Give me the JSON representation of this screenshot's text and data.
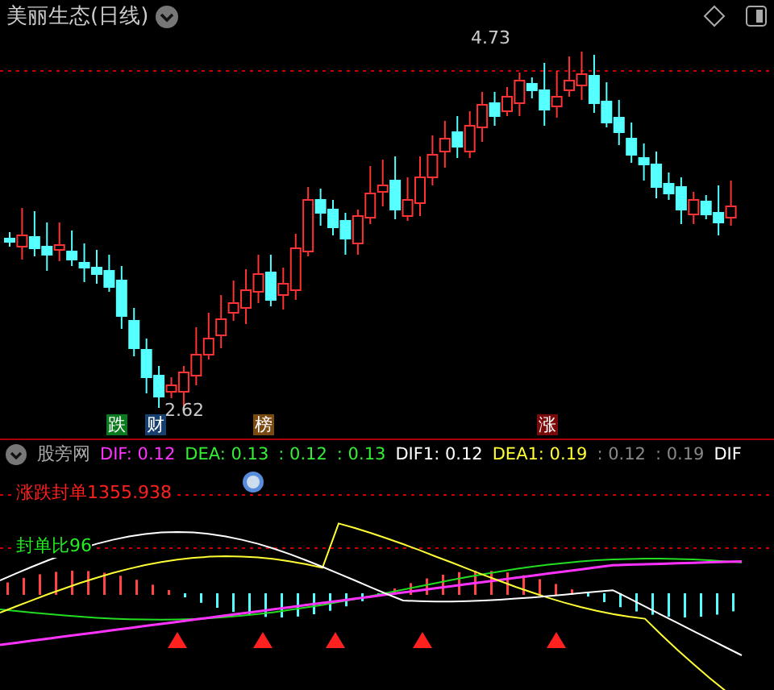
{
  "title": "美丽生态(日线)",
  "price_labels": [
    {
      "text": "4.73"
    },
    {
      "text": "2.62"
    }
  ],
  "signals": [
    {
      "text": "跌",
      "color": "#0b7a1e"
    },
    {
      "text": "财",
      "color": "#17406e"
    },
    {
      "text": "榜",
      "color": "#7a4a12"
    },
    {
      "text": "涨",
      "color": "#7a0a0a"
    }
  ],
  "indicator": {
    "name": "股旁网",
    "values": [
      {
        "text": "DIF: 0.12",
        "color": "#ff33ff"
      },
      {
        "text": "DEA: 0.13",
        "color": "#33ee33"
      },
      {
        "text": ": 0.12",
        "color": "#33ee33"
      },
      {
        "text": ": 0.13",
        "color": "#33ee33"
      },
      {
        "text": "DIF1: 0.12",
        "color": "#ffffff"
      },
      {
        "text": "DEA1: 0.19",
        "color": "#ffff33"
      },
      {
        "text": ": 0.12",
        "color": "#888888"
      },
      {
        "text": ": 0.19",
        "color": "#888888"
      },
      {
        "text": "DIF",
        "color": "#ffffff"
      }
    ]
  },
  "readouts": [
    {
      "text": "涨跌封单1355.938",
      "color": "#ff2020"
    },
    {
      "text": "封单比96",
      "color": "#22ee22"
    }
  ]
}
